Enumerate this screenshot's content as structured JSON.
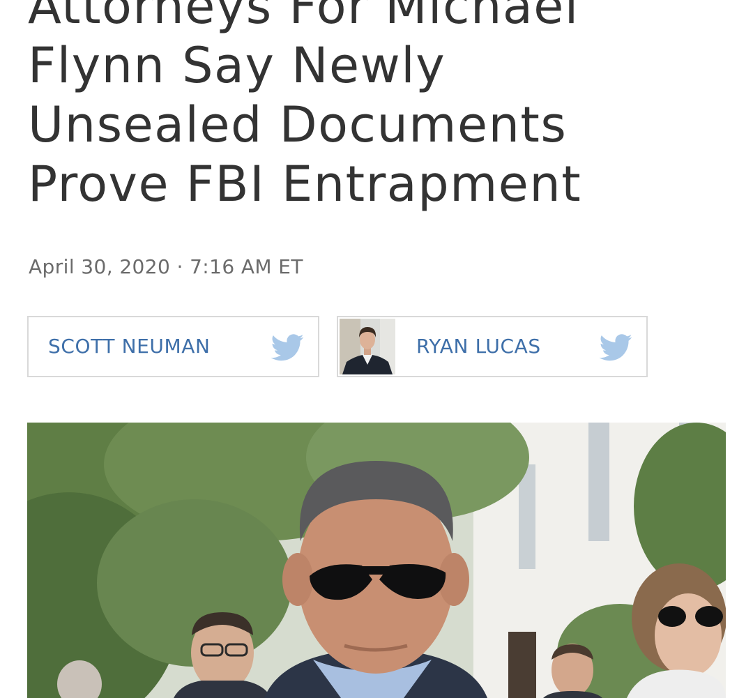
{
  "article": {
    "headline_lines": [
      "Attorneys For Michael",
      "Flynn Say Newly",
      "Unsealed Documents",
      "Prove FBI Entrapment"
    ],
    "dateline": "April 30, 2020 · 7:16 AM ET"
  },
  "bylines": [
    {
      "name": "SCOTT NEUMAN",
      "icon": "twitter-icon",
      "has_avatar": false
    },
    {
      "name": "RYAN LUCAS",
      "icon": "twitter-icon",
      "has_avatar": true
    }
  ],
  "colors": {
    "headline": "#333333",
    "dateline": "#6b6b6b",
    "author_link": "#3e6fa9",
    "twitter": "#a9c8e8",
    "border": "#d9d9d9"
  }
}
